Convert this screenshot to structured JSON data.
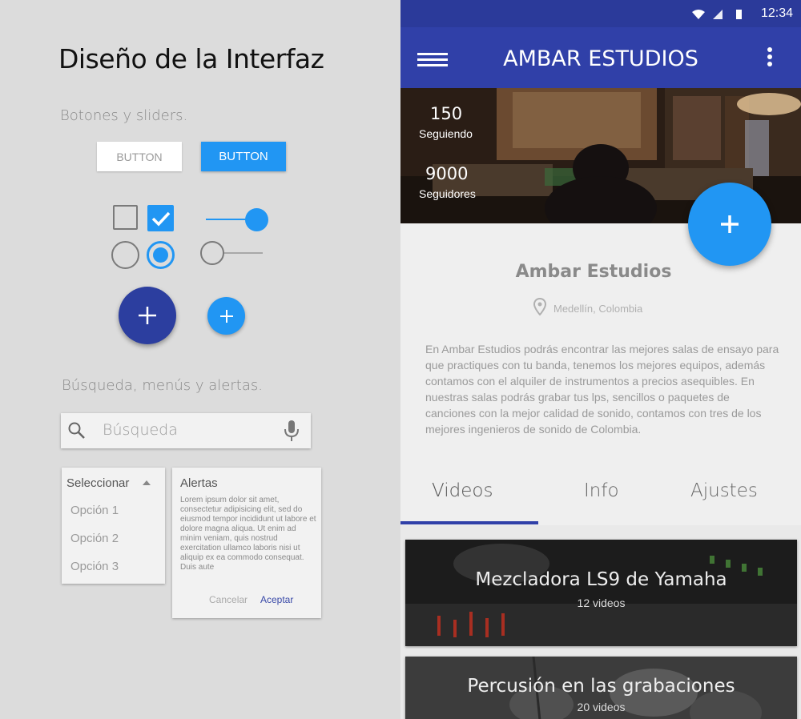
{
  "left": {
    "title": "Diseño de la Interfaz",
    "section_buttons": "Botones y sliders.",
    "btn_flat": "BUTTON",
    "btn_raised": "BUTTON",
    "section_search": "Búsqueda, menús y alertas.",
    "search_placeholder": "Búsqueda",
    "dropdown": {
      "header": "Seleccionar",
      "options": [
        "Opción 1",
        "Opción 2",
        "Opción 3"
      ]
    },
    "alert": {
      "title": "Alertas",
      "body": "Lorem ipsum dolor sit amet, consectetur adipisicing elit, sed do eiusmod tempor incididunt ut labore et dolore magna aliqua. Ut enim ad minim veniam, quis nostrud exercitation ullamco laboris nisi ut aliquip ex ea commodo consequat. Duis aute",
      "cancel": "Cancelar",
      "accept": "Aceptar"
    },
    "slider_values": [
      0.85,
      0.0
    ],
    "colors": {
      "primary": "#2196f3",
      "indigo": "#2c3e9f"
    }
  },
  "phone": {
    "status_time": "12:34",
    "app_title": "AMBAR ESTUDIOS",
    "following_count": "150",
    "following_label": "Seguiendo",
    "followers_count": "9000",
    "followers_label": "Seguidores",
    "profile_name": "Ambar Estudios",
    "location": "Medellín, Colombia",
    "description": "En Ambar Estudios podrás encontrar las mejores salas de ensayo para que practiques con tu banda, tenemos los mejores equipos, además contamos con el alquiler de instrumentos a precios asequibles. En nuestras salas podrás grabar tus lps, sencillos o paquetes de canciones con la mejor calidad de sonido, contamos con tres de los mejores ingenieros de sonido de Colombia.",
    "tabs": [
      "Videos",
      "Info",
      "Ajustes"
    ],
    "cards": [
      {
        "title": "Mezcladora LS9 de Yamaha",
        "subtitle": "12 videos"
      },
      {
        "title": "Percusión en las grabaciones",
        "subtitle": "20 videos"
      }
    ],
    "colors": {
      "appbar": "#3040a8",
      "statusbar": "#2b3a9a",
      "fab": "#2196f3"
    }
  }
}
